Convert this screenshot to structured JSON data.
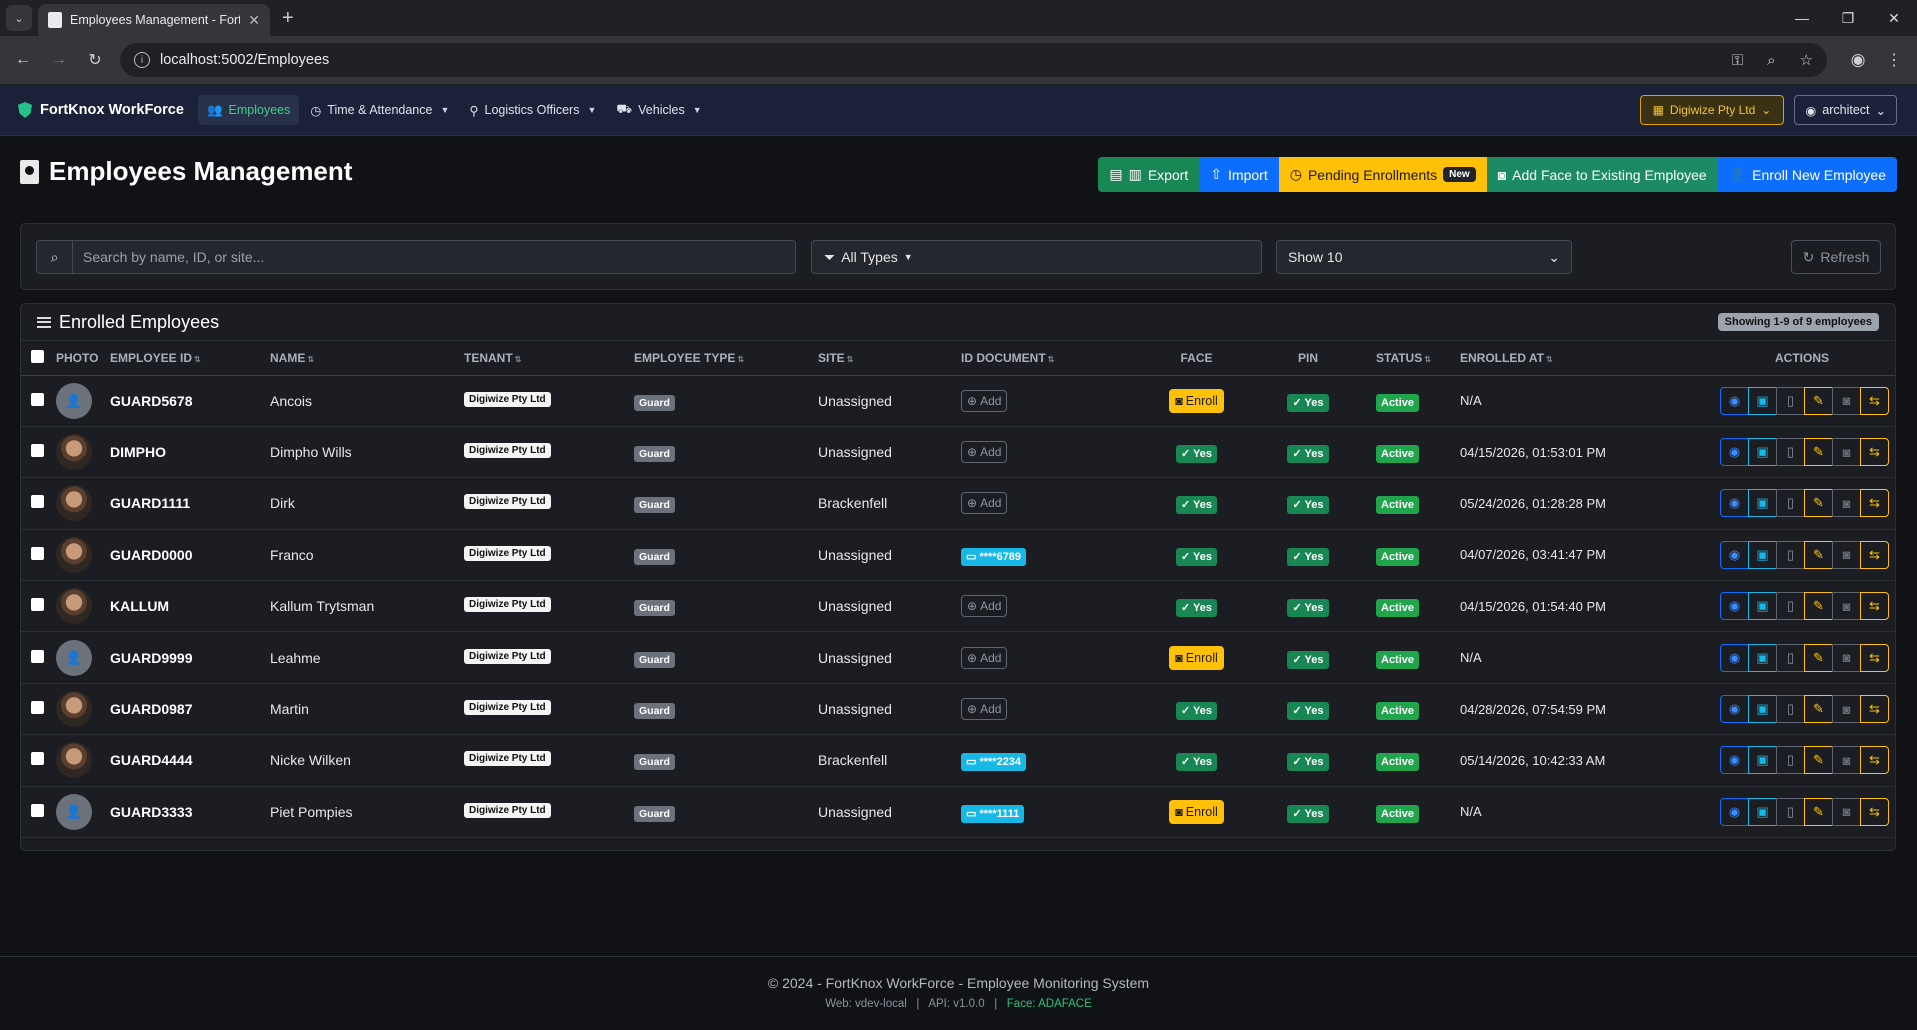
{
  "browser": {
    "tab_title": "Employees Management - FortKnox WorkForce",
    "url": "localhost:5002/Employees"
  },
  "nav": {
    "brand": "FortKnox WorkForce",
    "items": [
      {
        "label": "Employees",
        "icon": "users-icon"
      },
      {
        "label": "Time & Attendance",
        "icon": "clock-icon"
      },
      {
        "label": "Logistics Officers",
        "icon": "map-pin-icon"
      },
      {
        "label": "Vehicles",
        "icon": "truck-icon"
      }
    ],
    "tenant": "Digiwize Pty Ltd",
    "user": "architect"
  },
  "page": {
    "title": "Employees Management",
    "actions": {
      "export": "Export",
      "import": "Import",
      "pending": "Pending Enrollments",
      "pending_badge": "New",
      "add_face": "Add Face to Existing Employee",
      "enroll_new": "Enroll New Employee"
    }
  },
  "filters": {
    "search_placeholder": "Search by name, ID, or site...",
    "type": "All Types",
    "show": "Show 10",
    "refresh": "Refresh"
  },
  "table": {
    "title": "Enrolled Employees",
    "showing": "Showing 1-9 of 9 employees",
    "headers": {
      "photo": "PHOTO",
      "employee_id": "EMPLOYEE ID",
      "name": "NAME",
      "tenant": "TENANT",
      "employee_type": "EMPLOYEE TYPE",
      "site": "SITE",
      "id_document": "ID DOCUMENT",
      "face": "FACE",
      "pin": "PIN",
      "status": "STATUS",
      "enrolled_at": "ENROLLED AT",
      "actions": "ACTIONS"
    },
    "add_label": "Add",
    "enroll_label": "Enroll",
    "yes_label": "Yes",
    "rows": [
      {
        "id": "GUARD5678",
        "name": "Ancois",
        "tenant": "Digiwize Pty Ltd",
        "type": "Guard",
        "site": "Unassigned",
        "id_doc": "",
        "face": false,
        "pin": "Yes",
        "status": "Active",
        "enrolled": "N/A",
        "photo": false
      },
      {
        "id": "DIMPHO",
        "name": "Dimpho Wills",
        "tenant": "Digiwize Pty Ltd",
        "type": "Guard",
        "site": "Unassigned",
        "id_doc": "",
        "face": true,
        "pin": "Yes",
        "status": "Active",
        "enrolled": "04/15/2026, 01:53:01 PM",
        "photo": true
      },
      {
        "id": "GUARD1111",
        "name": "Dirk",
        "tenant": "Digiwize Pty Ltd",
        "type": "Guard",
        "site": "Brackenfell",
        "id_doc": "",
        "face": true,
        "pin": "Yes",
        "status": "Active",
        "enrolled": "05/24/2026, 01:28:28 PM",
        "photo": true
      },
      {
        "id": "GUARD0000",
        "name": "Franco",
        "tenant": "Digiwize Pty Ltd",
        "type": "Guard",
        "site": "Unassigned",
        "id_doc": "****6789",
        "face": true,
        "pin": "Yes",
        "status": "Active",
        "enrolled": "04/07/2026, 03:41:47 PM",
        "photo": true
      },
      {
        "id": "KALLUM",
        "name": "Kallum Trytsman",
        "tenant": "Digiwize Pty Ltd",
        "type": "Guard",
        "site": "Unassigned",
        "id_doc": "",
        "face": true,
        "pin": "Yes",
        "status": "Active",
        "enrolled": "04/15/2026, 01:54:40 PM",
        "photo": true
      },
      {
        "id": "GUARD9999",
        "name": "Leahme",
        "tenant": "Digiwize Pty Ltd",
        "type": "Guard",
        "site": "Unassigned",
        "id_doc": "",
        "face": false,
        "pin": "Yes",
        "status": "Active",
        "enrolled": "N/A",
        "photo": false
      },
      {
        "id": "GUARD0987",
        "name": "Martin",
        "tenant": "Digiwize Pty Ltd",
        "type": "Guard",
        "site": "Unassigned",
        "id_doc": "",
        "face": true,
        "pin": "Yes",
        "status": "Active",
        "enrolled": "04/28/2026, 07:54:59 PM",
        "photo": true
      },
      {
        "id": "GUARD4444",
        "name": "Nicke Wilken",
        "tenant": "Digiwize Pty Ltd",
        "type": "Guard",
        "site": "Brackenfell",
        "id_doc": "****2234",
        "face": true,
        "pin": "Yes",
        "status": "Active",
        "enrolled": "05/14/2026, 10:42:33 AM",
        "photo": true
      },
      {
        "id": "GUARD3333",
        "name": "Piet Pompies",
        "tenant": "Digiwize Pty Ltd",
        "type": "Guard",
        "site": "Unassigned",
        "id_doc": "****1111",
        "face": false,
        "pin": "Yes",
        "status": "Active",
        "enrolled": "N/A",
        "photo": false
      }
    ]
  },
  "footer": {
    "copyright": "© 2024 - FortKnox WorkForce - Employee Monitoring System",
    "web": "Web: vdev-local",
    "api": "API: v1.0.0",
    "face": "Face: ADAFACE"
  }
}
